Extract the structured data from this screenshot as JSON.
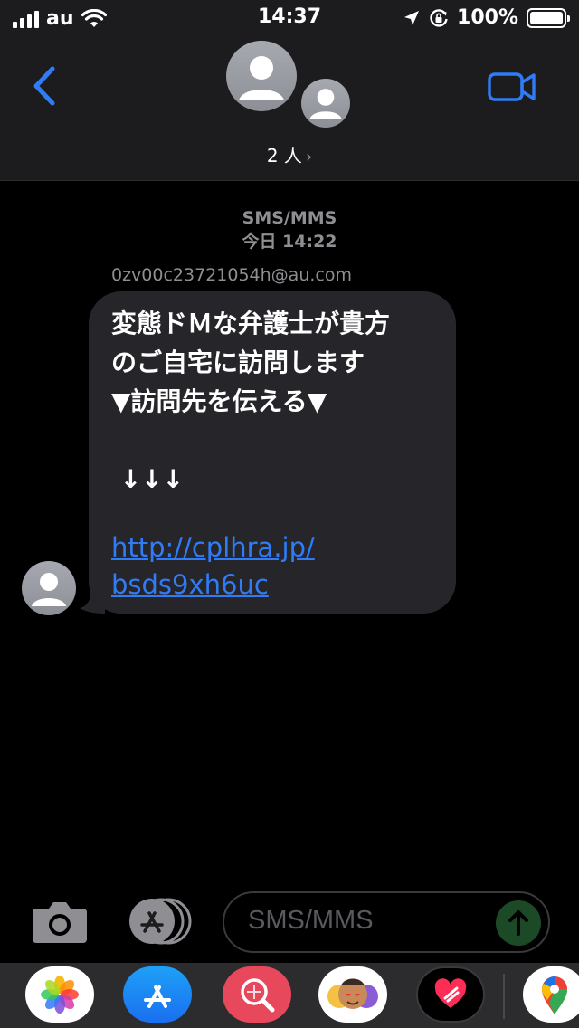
{
  "status_bar": {
    "carrier": "au",
    "time": "14:37",
    "battery": "100%",
    "battery_level": 1.0,
    "signal_bars": 4
  },
  "header": {
    "participants_label": "2 人",
    "chevron": "›",
    "back_icon": "chevron-left-icon",
    "video_icon": "video-camera-icon"
  },
  "thread": {
    "service_label": "SMS/MMS",
    "timestamp": "今日 14:22",
    "sender": "0zv00c23721054h@au.com",
    "message_text": "変態ドＭな弁護士が貴方\nのご自宅に訪問します\n▼訪問先を伝える▼\n\n ↓↓↓\n",
    "message_link": "http://cplhra.jp/\nbsds9xh6uc"
  },
  "composer": {
    "placeholder": "SMS/MMS",
    "camera_icon": "camera-icon",
    "apps_icon": "app-store-icon",
    "send_icon": "send-arrow-icon"
  },
  "app_drawer": {
    "apps": [
      "photos-icon",
      "app-store-icon",
      "image-search-icon",
      "memoji-icon",
      "digital-touch-icon",
      "maps-icon"
    ]
  },
  "colors": {
    "accent": "#2f7cf6",
    "bubble": "#26252a",
    "header_bg": "#1c1c1e",
    "secondary_text": "#8e8e93"
  }
}
